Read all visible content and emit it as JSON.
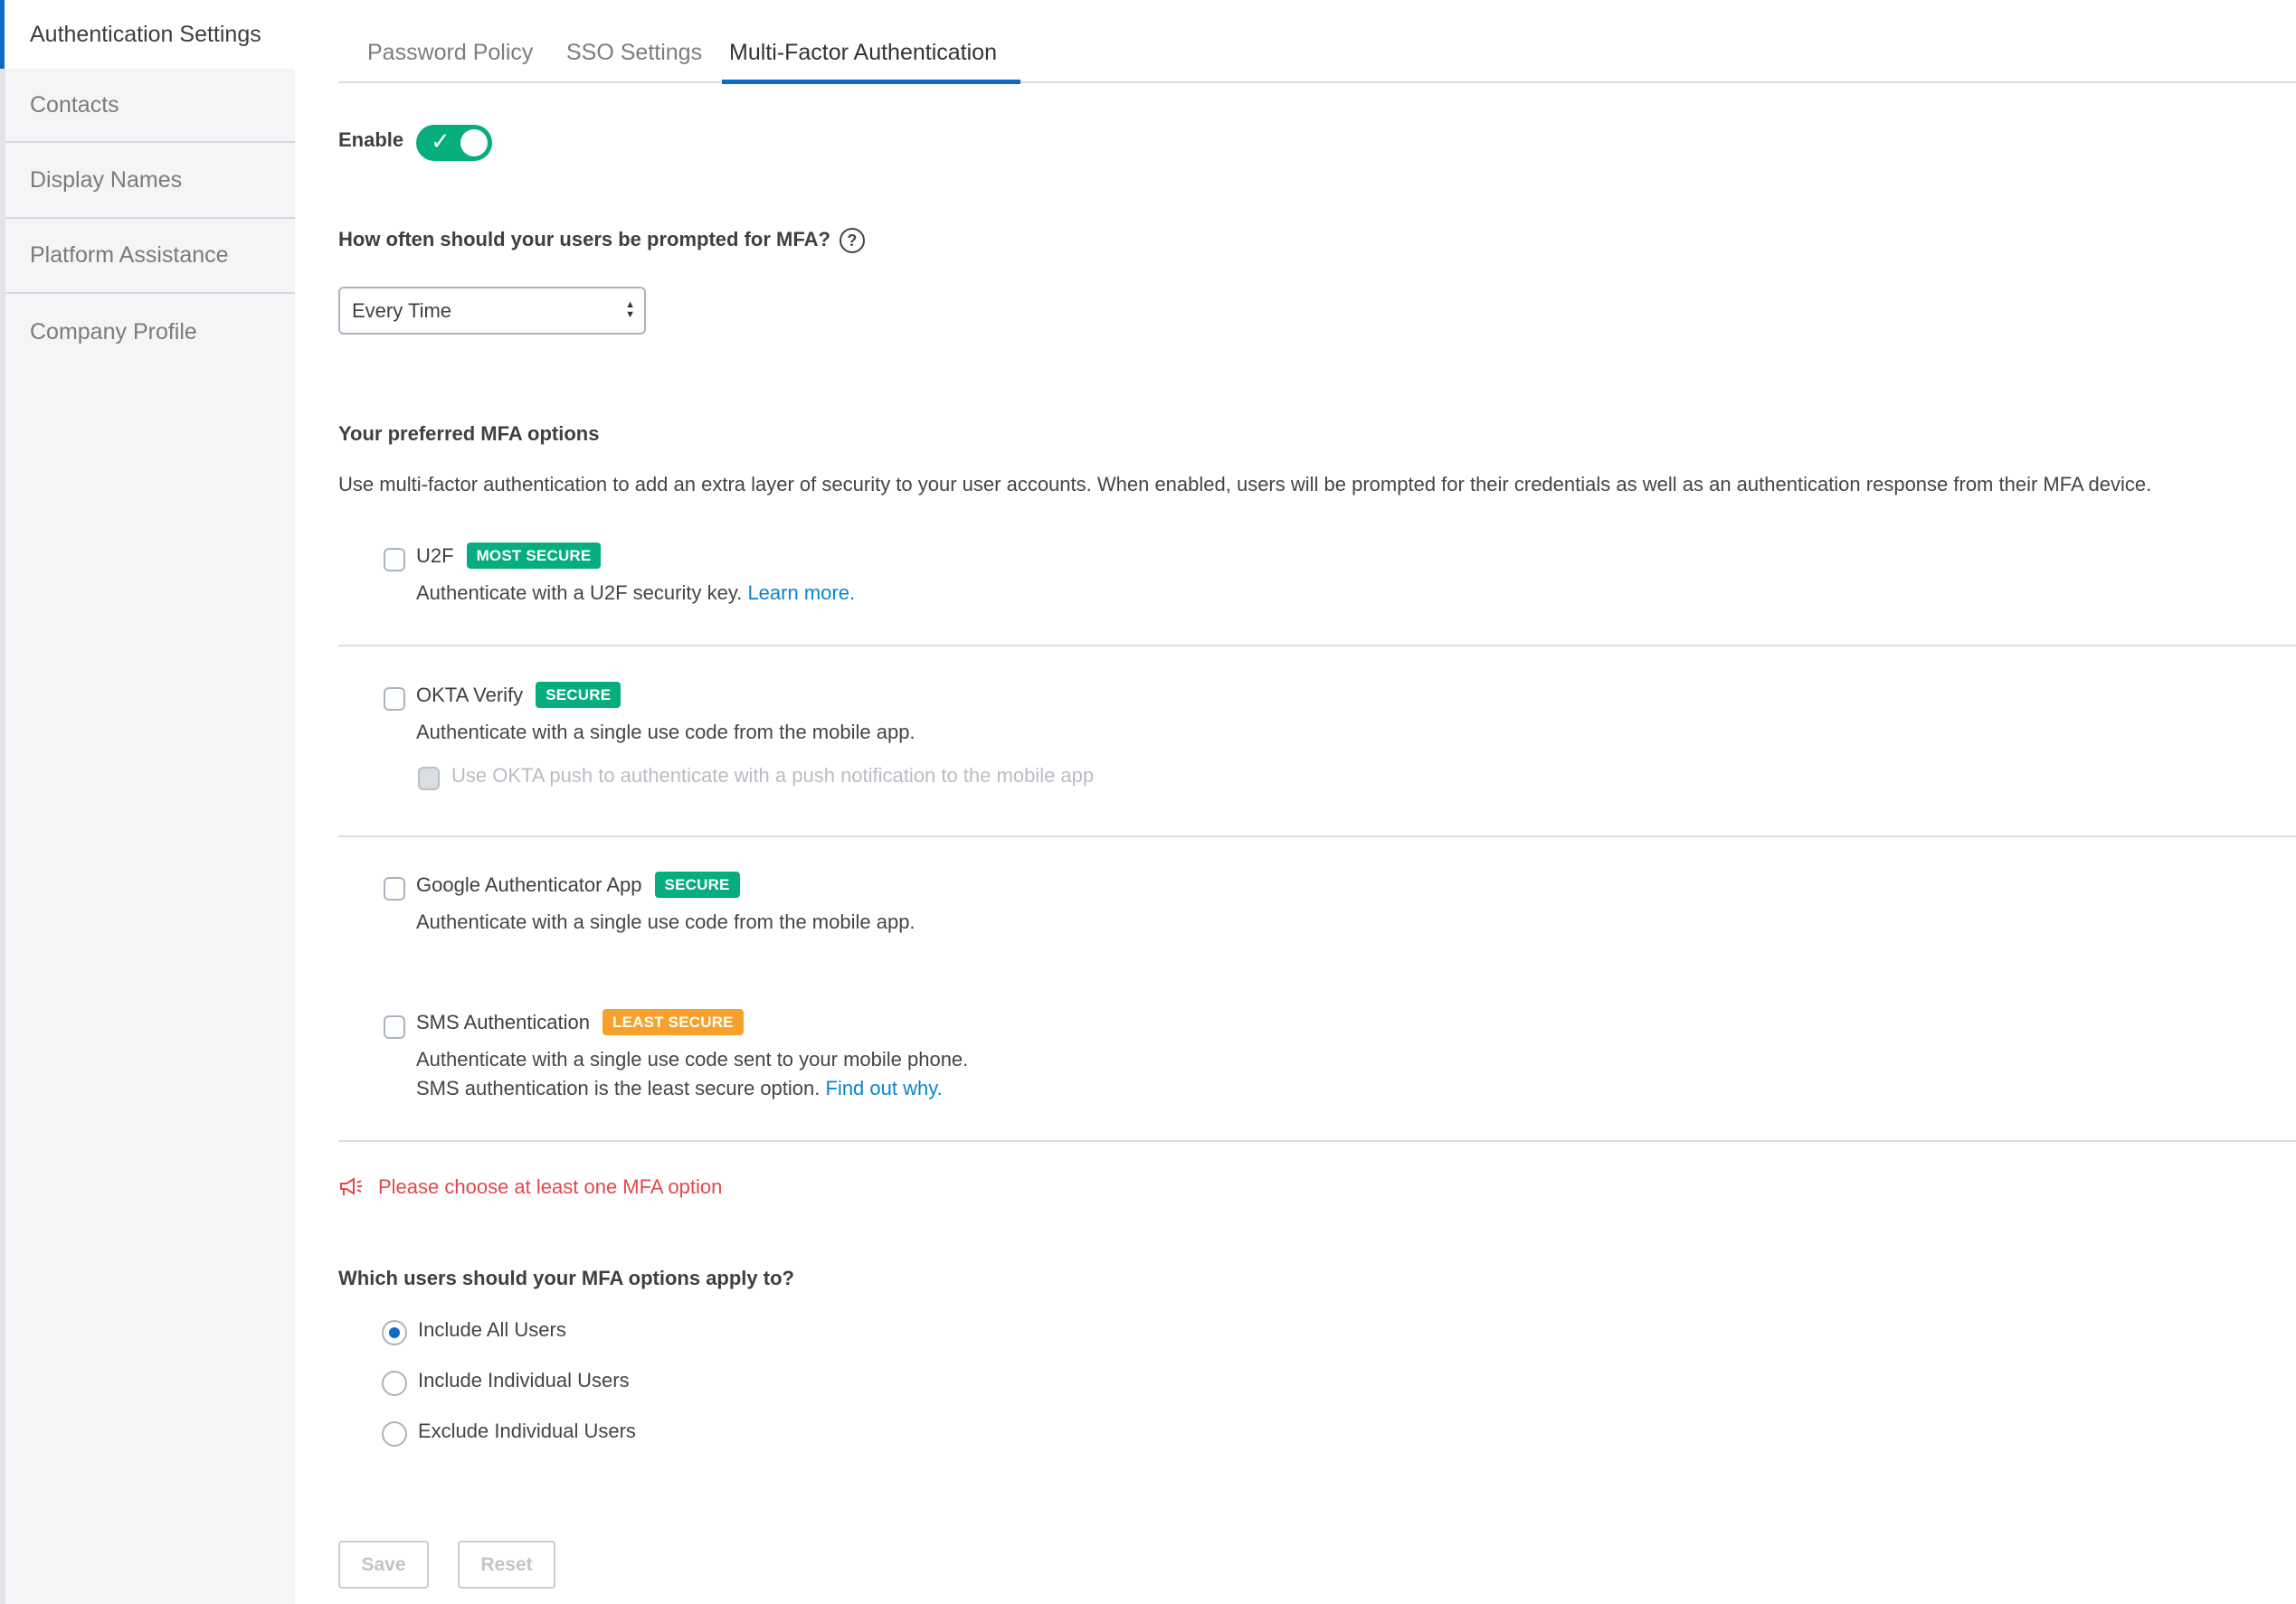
{
  "sidebar": {
    "items": [
      {
        "label": "Authentication Settings",
        "active": true
      },
      {
        "label": "Contacts"
      },
      {
        "label": "Display Names"
      },
      {
        "label": "Platform Assistance"
      },
      {
        "label": "Company Profile"
      }
    ]
  },
  "tabs": [
    {
      "label": "Password Policy"
    },
    {
      "label": "SSO Settings"
    },
    {
      "label": "Multi-Factor Authentication",
      "active": true
    }
  ],
  "enable": {
    "label": "Enable",
    "on": true,
    "check_glyph": "✓"
  },
  "frequency": {
    "question": "How often should your users be prompted for MFA?",
    "help_glyph": "?",
    "selected": "Every Time"
  },
  "options_section": {
    "heading": "Your preferred MFA options",
    "description": "Use multi-factor authentication to add an extra layer of security to your user accounts. When enabled, users will be prompted for their credentials as well as an authentication response from their MFA device.",
    "options": [
      {
        "title": "U2F",
        "badge": "MOST SECURE",
        "badge_color": "#06ad7e",
        "checked": false,
        "desc": "Authenticate with a U2F security key.",
        "link": "Learn more."
      },
      {
        "title": "OKTA Verify",
        "badge": "SECURE",
        "badge_color": "#06ad7e",
        "checked": false,
        "desc": "Authenticate with a single use code from the mobile app.",
        "sub_option": {
          "label": "Use OKTA push to authenticate with a push notification to the mobile app",
          "disabled": true,
          "checked": false
        }
      },
      {
        "title": "Google Authenticator App",
        "badge": "SECURE",
        "badge_color": "#06ad7e",
        "checked": false,
        "desc": "Authenticate with a single use code from the mobile app."
      },
      {
        "title": "SMS Authentication",
        "badge": "LEAST SECURE",
        "badge_color": "#f6a12c",
        "checked": false,
        "desc": "Authenticate with a single use code sent to your mobile phone.",
        "desc2": "SMS authentication is the least secure option.",
        "link": "Find out why."
      }
    ]
  },
  "error": {
    "message": "Please choose at least one MFA option",
    "color": "#e3474d"
  },
  "users_section": {
    "question": "Which users should your MFA options apply to?",
    "options": [
      {
        "label": "Include All Users",
        "selected": true
      },
      {
        "label": "Include Individual Users",
        "selected": false
      },
      {
        "label": "Exclude Individual Users",
        "selected": false
      }
    ]
  },
  "buttons": {
    "save": "Save",
    "reset": "Reset",
    "disabled": true
  },
  "colors": {
    "accent": "#0f6ac4",
    "success": "#06ad7e",
    "warning": "#f6a12c",
    "link": "#0b84c9"
  }
}
